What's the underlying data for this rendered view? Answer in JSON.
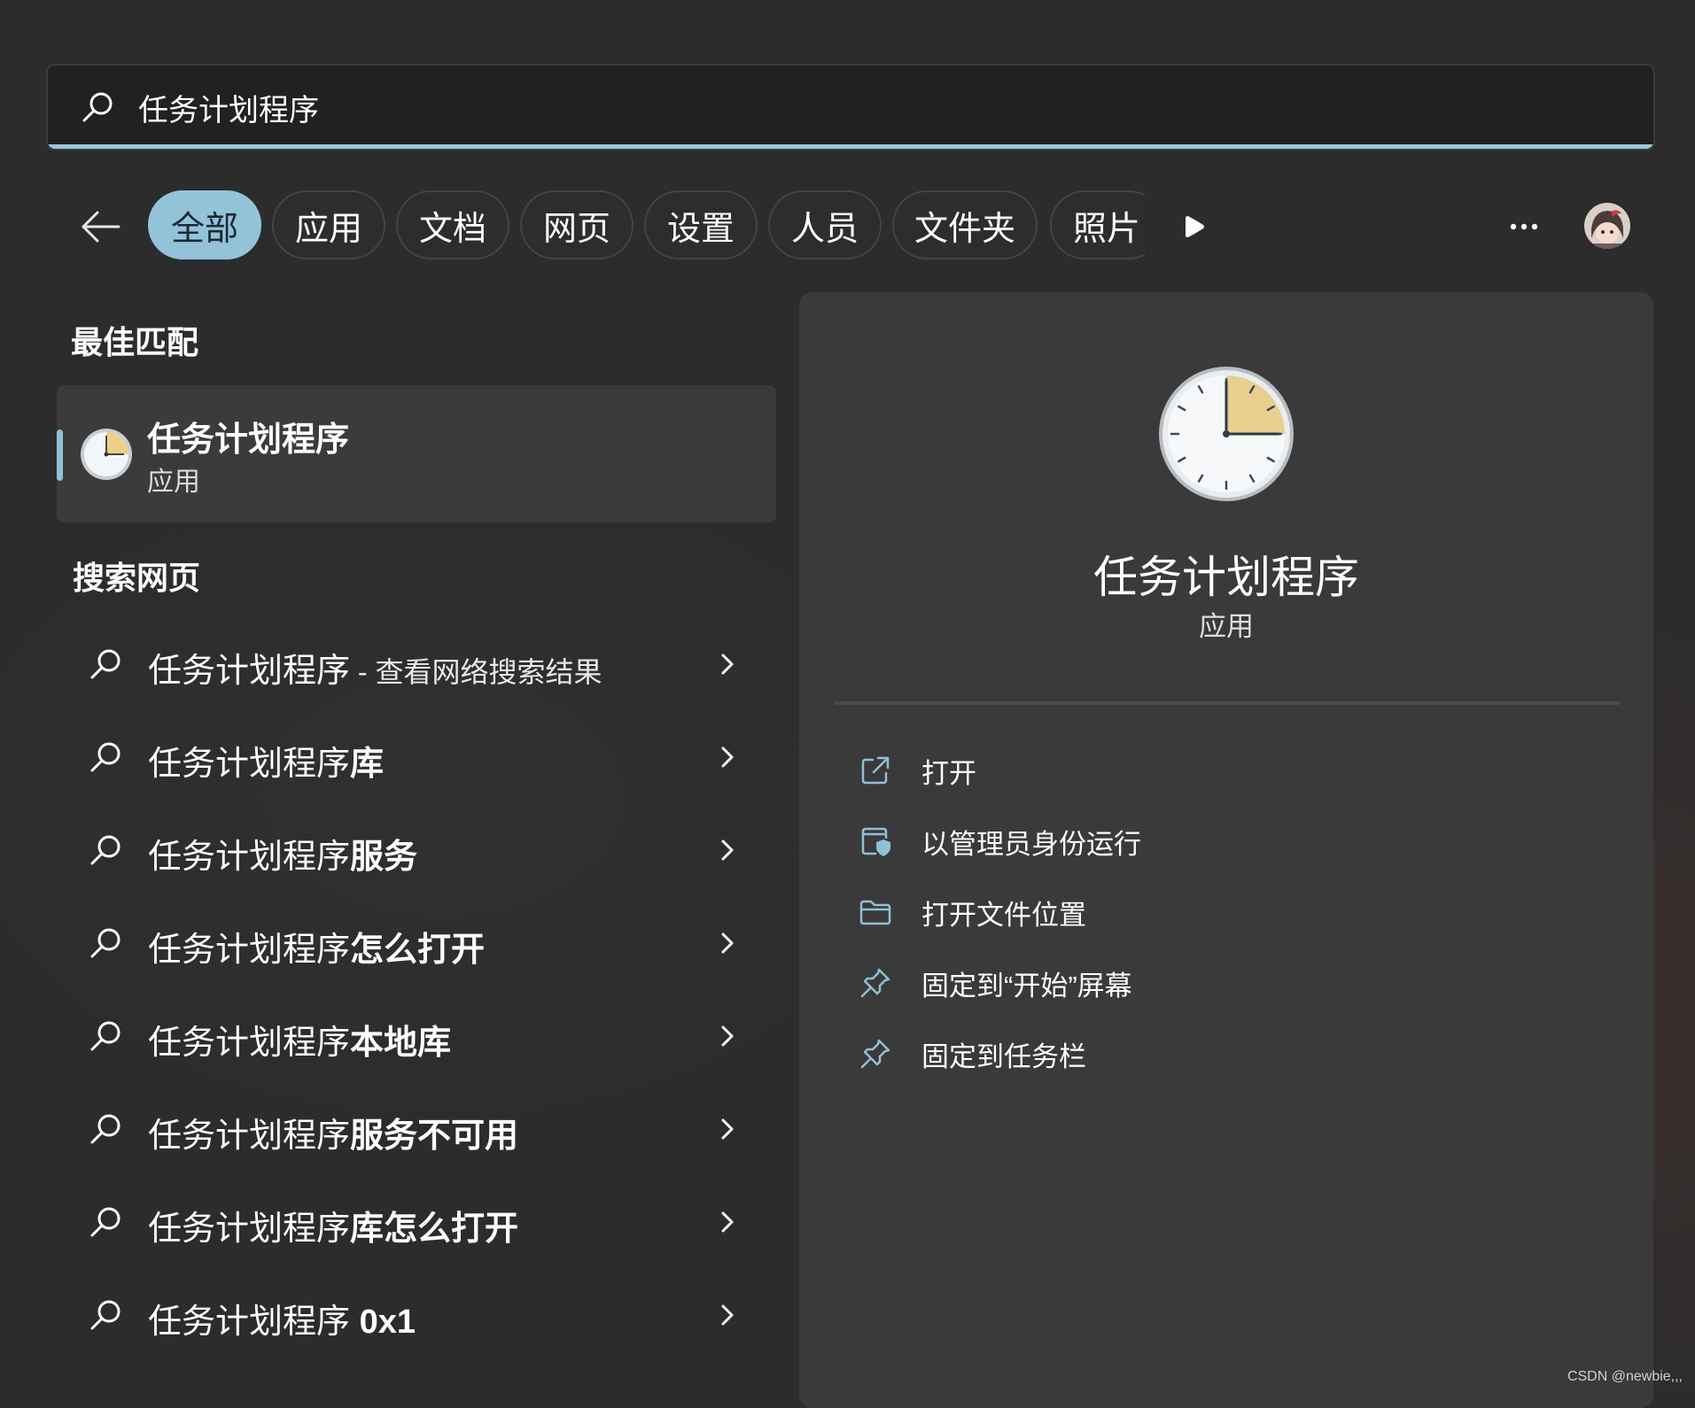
{
  "search": {
    "query": "任务计划程序"
  },
  "filters": {
    "tabs": [
      {
        "label": "全部",
        "active": true
      },
      {
        "label": "应用",
        "active": false
      },
      {
        "label": "文档",
        "active": false
      },
      {
        "label": "网页",
        "active": false
      },
      {
        "label": "设置",
        "active": false
      },
      {
        "label": "人员",
        "active": false
      },
      {
        "label": "文件夹",
        "active": false
      },
      {
        "label": "照片",
        "active": false
      }
    ],
    "more_label": "···"
  },
  "best_match": {
    "heading": "最佳匹配",
    "title": "任务计划程序",
    "type": "应用",
    "icon": "clock-icon"
  },
  "web_search": {
    "heading": "搜索网页",
    "items": [
      {
        "prefix": "任务计划程序",
        "bold": "",
        "suffix": " - 查看网络搜索结果"
      },
      {
        "prefix": "任务计划程序",
        "bold": "库",
        "suffix": ""
      },
      {
        "prefix": "任务计划程序",
        "bold": "服务",
        "suffix": ""
      },
      {
        "prefix": "任务计划程序",
        "bold": "怎么打开",
        "suffix": ""
      },
      {
        "prefix": "任务计划程序",
        "bold": "本地库",
        "suffix": ""
      },
      {
        "prefix": "任务计划程序",
        "bold": "服务不可用",
        "suffix": ""
      },
      {
        "prefix": "任务计划程序",
        "bold": "库怎么打开",
        "suffix": ""
      },
      {
        "prefix": "任务计划程序 ",
        "bold": "0x1",
        "suffix": ""
      }
    ]
  },
  "detail": {
    "title": "任务计划程序",
    "type": "应用",
    "actions": [
      {
        "label": "打开",
        "icon": "open-external-icon"
      },
      {
        "label": "以管理员身份运行",
        "icon": "shield-window-icon"
      },
      {
        "label": "打开文件位置",
        "icon": "folder-icon"
      },
      {
        "label": "固定到“开始”屏幕",
        "icon": "pin-icon"
      },
      {
        "label": "固定到任务栏",
        "icon": "pin-icon"
      }
    ]
  },
  "colors": {
    "accent": "#93c3d9",
    "background": "#2c2c2c",
    "panel": "#3a3a3a"
  },
  "watermark": "CSDN @newbie,,,"
}
